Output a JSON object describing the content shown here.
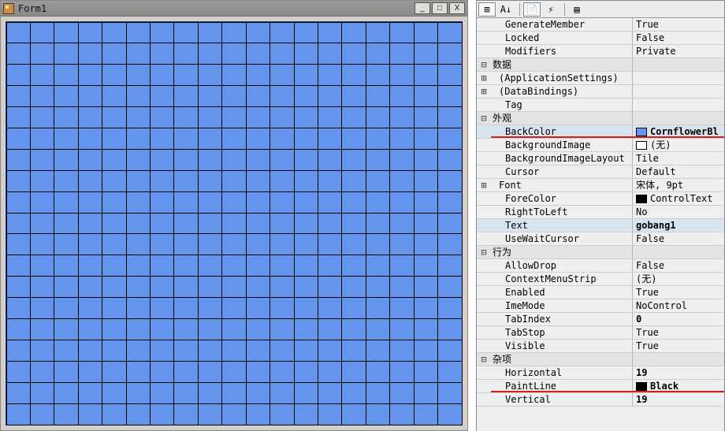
{
  "form": {
    "title": "Form1",
    "grid_lines_h": 19,
    "grid_lines_v": 19,
    "back_color": "#6495ED",
    "line_color": "#000000",
    "winbtns": {
      "min": "_",
      "max": "□",
      "close": "X"
    }
  },
  "toolbar": {
    "btn_categorized": "⊞",
    "btn_az": "A↓",
    "btn_prop": "📄",
    "btn_events": "⚡",
    "btn_pages": "▤"
  },
  "properties": [
    {
      "kind": "prop",
      "marker": "",
      "indent": 2,
      "name": "GenerateMember",
      "value": "True"
    },
    {
      "kind": "prop",
      "marker": "",
      "indent": 2,
      "name": "Locked",
      "value": "False"
    },
    {
      "kind": "prop",
      "marker": "",
      "indent": 2,
      "name": "Modifiers",
      "value": "Private"
    },
    {
      "kind": "cat",
      "marker": "⊟",
      "indent": 0,
      "name": "数据",
      "value": ""
    },
    {
      "kind": "prop",
      "marker": "⊞",
      "indent": 1,
      "name": "(ApplicationSettings)",
      "value": ""
    },
    {
      "kind": "prop",
      "marker": "⊞",
      "indent": 1,
      "name": "(DataBindings)",
      "value": ""
    },
    {
      "kind": "prop",
      "marker": "",
      "indent": 2,
      "name": "Tag",
      "value": ""
    },
    {
      "kind": "cat",
      "marker": "⊟",
      "indent": 0,
      "name": "外观",
      "value": ""
    },
    {
      "kind": "prop",
      "marker": "",
      "indent": 2,
      "name": "BackColor",
      "value": "CornflowerBl",
      "swatch": "#6495ED",
      "bold": true,
      "red_underline": true,
      "selected": true
    },
    {
      "kind": "prop",
      "marker": "",
      "indent": 2,
      "name": "BackgroundImage",
      "value": "(无)",
      "swatch": "#ffffff"
    },
    {
      "kind": "prop",
      "marker": "",
      "indent": 2,
      "name": "BackgroundImageLayout",
      "value": "Tile"
    },
    {
      "kind": "prop",
      "marker": "",
      "indent": 2,
      "name": "Cursor",
      "value": "Default"
    },
    {
      "kind": "prop",
      "marker": "⊞",
      "indent": 1,
      "name": "Font",
      "value": "宋体, 9pt"
    },
    {
      "kind": "prop",
      "marker": "",
      "indent": 2,
      "name": "ForeColor",
      "value": "ControlText",
      "swatch": "#000000"
    },
    {
      "kind": "prop",
      "marker": "",
      "indent": 2,
      "name": "RightToLeft",
      "value": "No"
    },
    {
      "kind": "prop",
      "marker": "",
      "indent": 2,
      "name": "Text",
      "value": "gobang1",
      "bold": true,
      "selected": true
    },
    {
      "kind": "prop",
      "marker": "",
      "indent": 2,
      "name": "UseWaitCursor",
      "value": "False"
    },
    {
      "kind": "cat",
      "marker": "⊟",
      "indent": 0,
      "name": "行为",
      "value": ""
    },
    {
      "kind": "prop",
      "marker": "",
      "indent": 2,
      "name": "AllowDrop",
      "value": "False"
    },
    {
      "kind": "prop",
      "marker": "",
      "indent": 2,
      "name": "ContextMenuStrip",
      "value": "(无)"
    },
    {
      "kind": "prop",
      "marker": "",
      "indent": 2,
      "name": "Enabled",
      "value": "True"
    },
    {
      "kind": "prop",
      "marker": "",
      "indent": 2,
      "name": "ImeMode",
      "value": "NoControl"
    },
    {
      "kind": "prop",
      "marker": "",
      "indent": 2,
      "name": "TabIndex",
      "value": "0",
      "bold": true
    },
    {
      "kind": "prop",
      "marker": "",
      "indent": 2,
      "name": "TabStop",
      "value": "True"
    },
    {
      "kind": "prop",
      "marker": "",
      "indent": 2,
      "name": "Visible",
      "value": "True"
    },
    {
      "kind": "cat",
      "marker": "⊟",
      "indent": 0,
      "name": "杂项",
      "value": ""
    },
    {
      "kind": "prop",
      "marker": "",
      "indent": 2,
      "name": "Horizontal",
      "value": "19",
      "bold": true
    },
    {
      "kind": "prop",
      "marker": "",
      "indent": 2,
      "name": "PaintLine",
      "value": "Black",
      "swatch": "#000000",
      "bold": true,
      "red_underline": true
    },
    {
      "kind": "prop",
      "marker": "",
      "indent": 2,
      "name": "Vertical",
      "value": "19",
      "bold": true
    }
  ]
}
